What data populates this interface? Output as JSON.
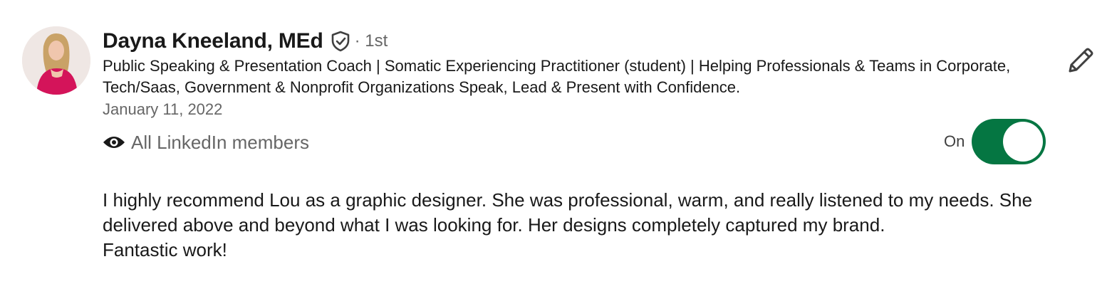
{
  "recommender": {
    "name": "Dayna Kneeland, MEd",
    "degree": "· 1st",
    "headline": "Public Speaking & Presentation Coach | Somatic Experiencing Practitioner (student) | Helping Professionals & Teams in Corporate, Tech/Saas, Government & Nonprofit Organizations Speak, Lead & Present with Confidence.",
    "date": "January 11, 2022"
  },
  "visibility": {
    "icon": "eye-icon",
    "label": "All LinkedIn members"
  },
  "toggle": {
    "label": "On",
    "state": "on",
    "color": "#057642"
  },
  "recommendation": {
    "paragraph1": "I highly recommend Lou as a graphic designer. She was professional, warm, and really listened to my needs. She delivered above and beyond what I was looking for. Her designs completely captured my brand.",
    "paragraph2": "Fantastic work!"
  },
  "icons": {
    "verified": "shield-check-icon",
    "edit": "pencil-icon"
  }
}
